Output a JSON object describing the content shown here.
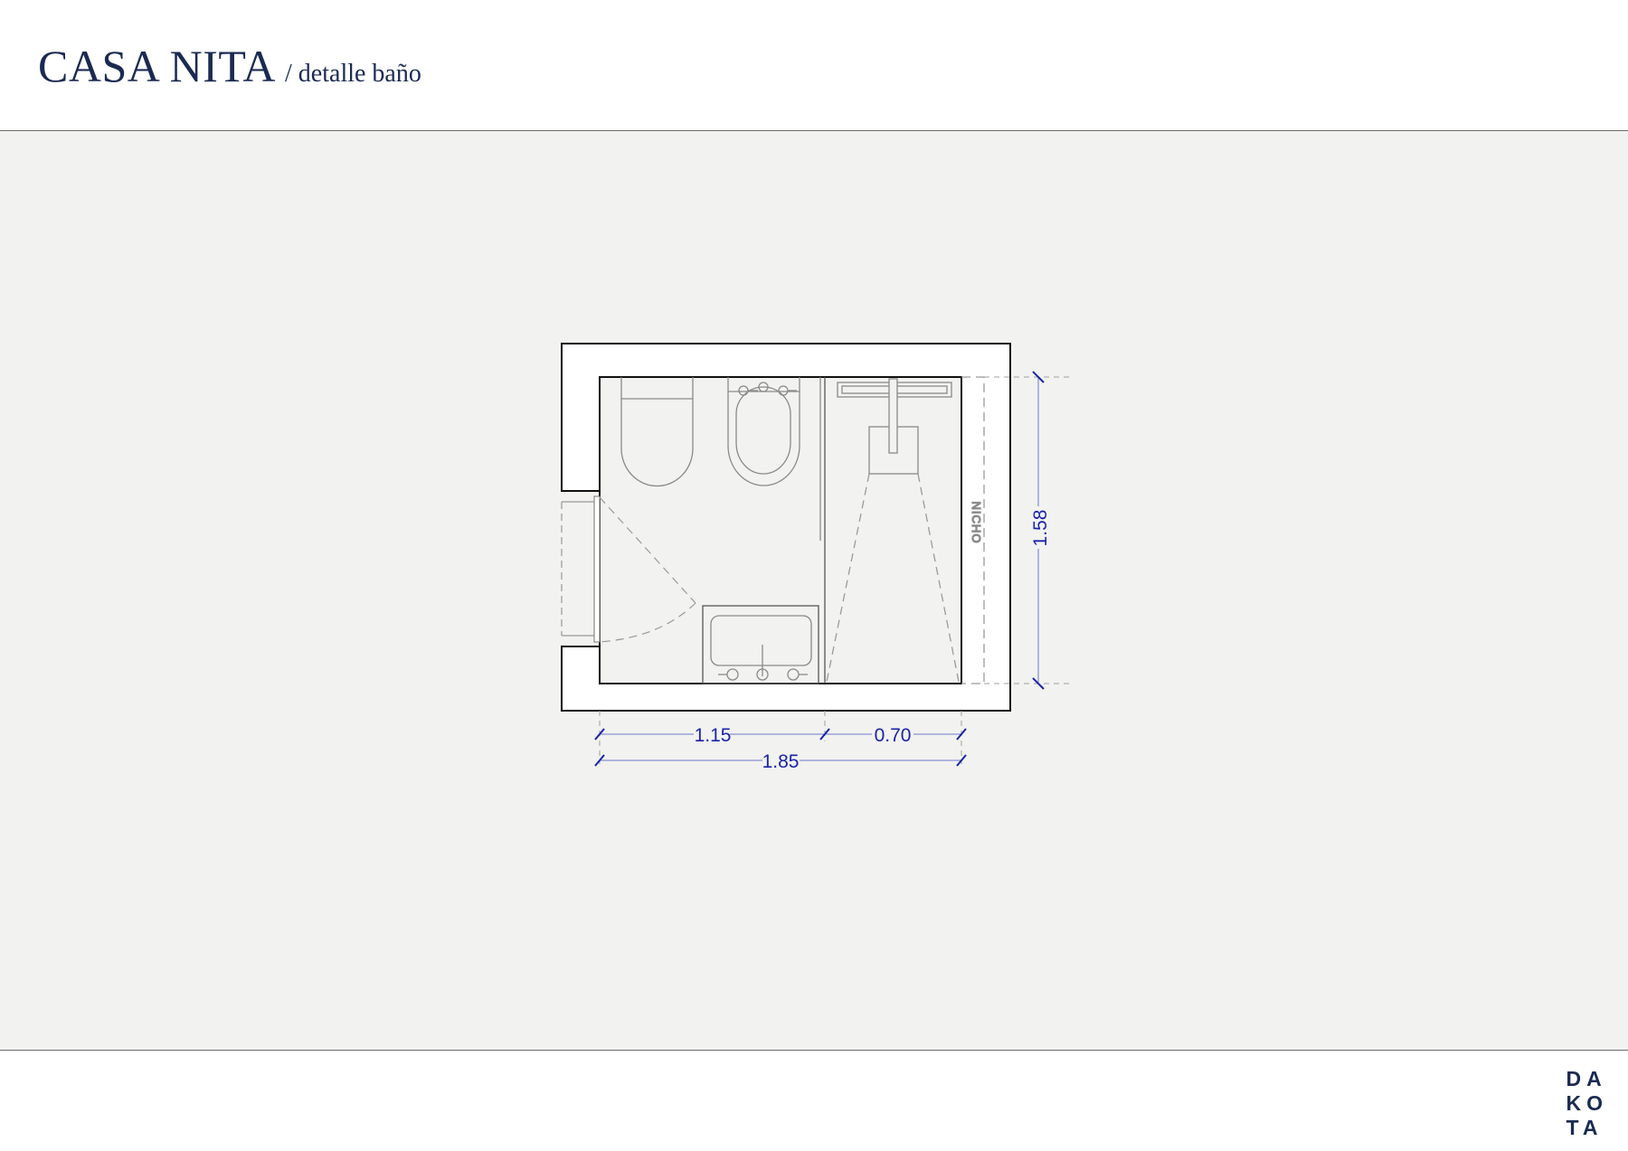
{
  "header": {
    "title": "CASA NITA",
    "subtitle": "/ detalle baño"
  },
  "plan": {
    "niche_label": "NICHO",
    "dimensions": {
      "width_sink_zone": "1.15",
      "width_shower_zone": "0.70",
      "total_width": "1.85",
      "depth": "1.58"
    }
  },
  "footer": {
    "logo_lines": [
      "DA",
      "KO",
      "TA"
    ]
  },
  "colors": {
    "title": "#1b2a52",
    "dimension": "#1a23a8",
    "canvas": "#f2f2f0"
  }
}
